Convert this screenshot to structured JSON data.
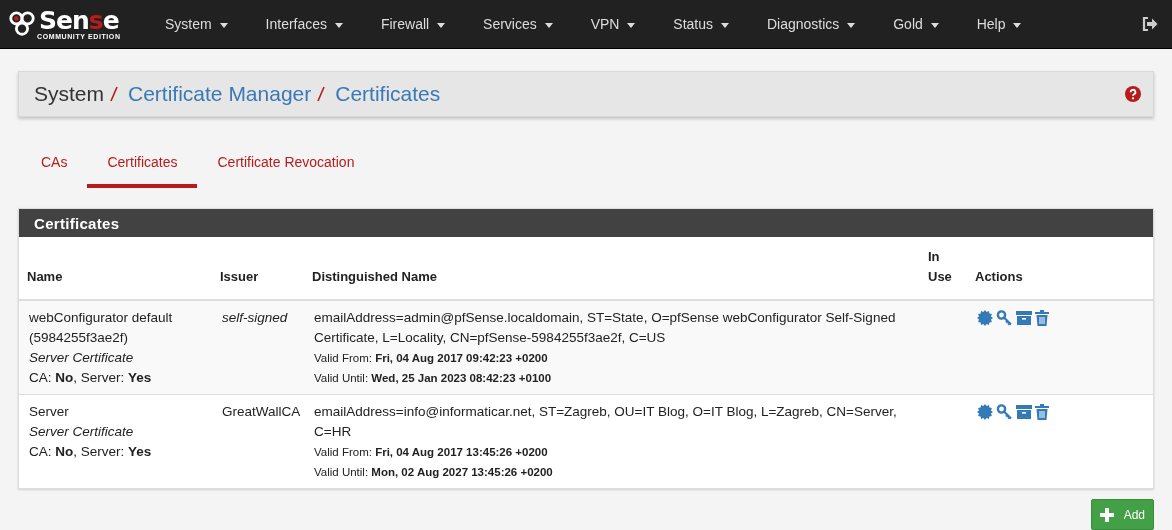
{
  "brand": {
    "wordmark": [
      {
        "text": "Sen",
        "accent": false
      },
      {
        "text": "s",
        "accent": true
      },
      {
        "text": "e",
        "accent": false
      }
    ],
    "edition": "COMMUNITY EDITION"
  },
  "nav": [
    "System",
    "Interfaces",
    "Firewall",
    "Services",
    "VPN",
    "Status",
    "Diagnostics",
    "Gold",
    "Help"
  ],
  "breadcrumb": [
    {
      "text": "System",
      "link": false
    },
    {
      "text": "Certificate Manager",
      "link": true
    },
    {
      "text": "Certificates",
      "link": true
    }
  ],
  "tabs": [
    {
      "label": "CAs",
      "selected": false
    },
    {
      "label": "Certificates",
      "selected": true
    },
    {
      "label": "Certificate Revocation",
      "selected": false
    }
  ],
  "panel": {
    "title": "Certificates",
    "columns": [
      "Name",
      "Issuer",
      "Distinguished Name",
      "In Use",
      "Actions"
    ],
    "rows": [
      {
        "name": "webConfigurator default (5984255f3ae2f)",
        "type": "Server Certificate",
        "flags": "CA: **No**, Server: **Yes**",
        "issuer": "self-signed",
        "issuer_italic": true,
        "dn": "emailAddress=admin@pfSense.localdomain, ST=State, O=pfSense webConfigurator Self-Signed Certificate, L=Locality, CN=pfSense-5984255f3ae2f, C=US",
        "valid_from": "Valid From: **Fri, 04 Aug 2017 09:42:23 +0200**",
        "valid_until": "Valid Until: **Wed, 25 Jan 2023 08:42:23 +0100**"
      },
      {
        "name": "Server",
        "type": "Server Certificate",
        "flags": "CA: **No**, Server: **Yes**",
        "issuer": "GreatWallCA",
        "issuer_italic": false,
        "dn": "emailAddress=info@informaticar.net, ST=Zagreb, OU=IT Blog, O=IT Blog, L=Zagreb, CN=Server, C=HR",
        "valid_from": "Valid From: **Fri, 04 Aug 2017 13:45:26 +0200**",
        "valid_until": "Valid Until: **Mon, 02 Aug 2027 13:45:26 +0200**"
      }
    ]
  },
  "add_button": "Add"
}
